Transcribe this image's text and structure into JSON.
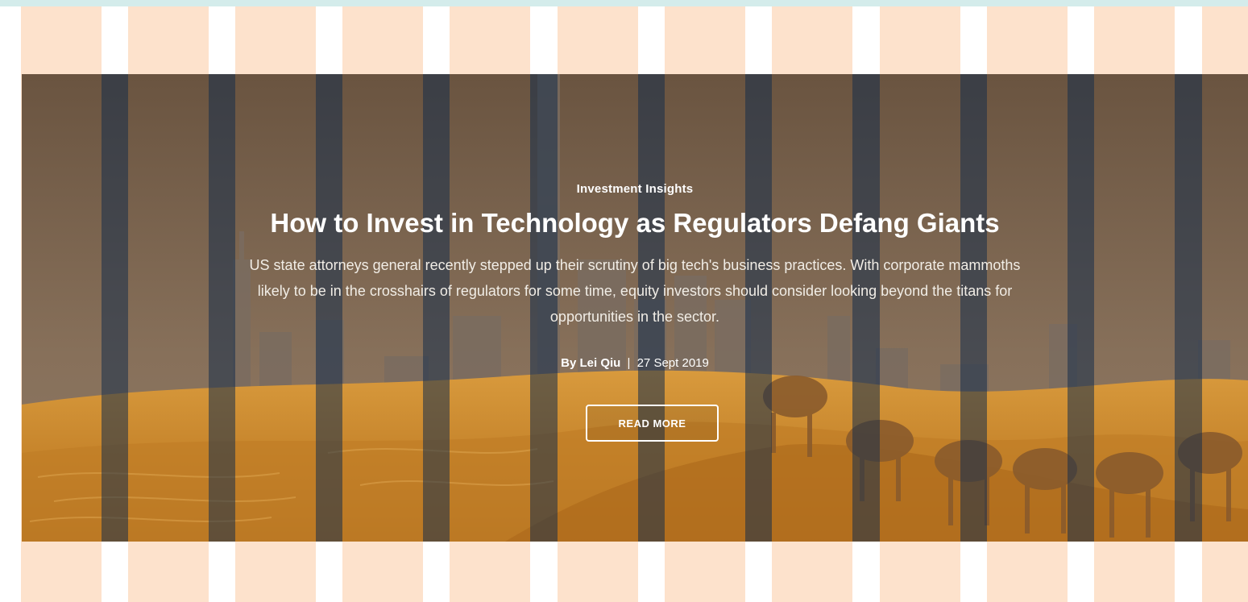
{
  "hero": {
    "category": "Investment Insights",
    "headline": "How to Invest in Technology as Regulators Defang Giants",
    "summary": "US state attorneys general recently stepped up their scrutiny of big tech's business practices. With corporate mammoths likely to be in the crosshairs of regulators for some time, equity investors should consider looking beyond the titans for opportunities in the sector.",
    "byline": {
      "author": "By Lei Qiu",
      "separator": "|",
      "date": "27 Sept 2019"
    },
    "cta_label": "READ MORE"
  },
  "colors": {
    "grid_column": "#fde2cc",
    "grid_overlay": "#162d4b",
    "top_bar": "#d4eceb",
    "sand": "#c98a2f",
    "sky": "#6f5a43"
  }
}
